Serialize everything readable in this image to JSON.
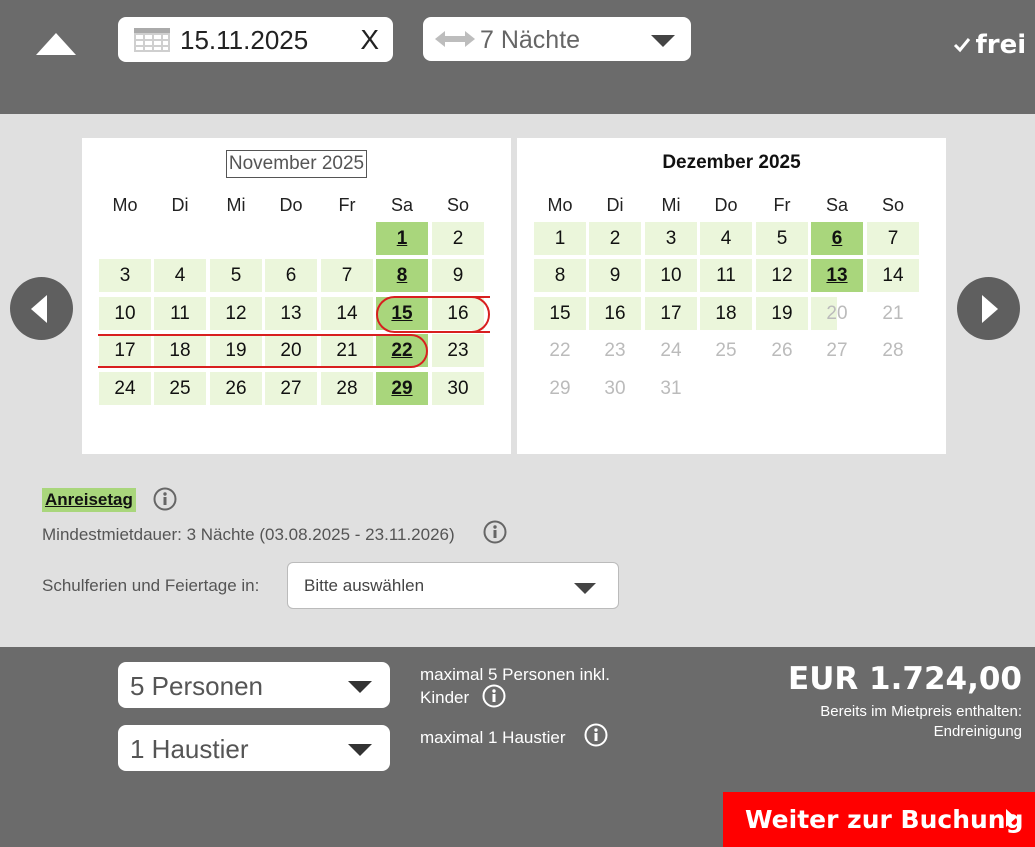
{
  "header": {
    "arrival_date": "15.11.2025",
    "clear_label": "X",
    "nights_label": "7 Nächte",
    "availability_label": "frei"
  },
  "calendar": {
    "weekdays": [
      "Mo",
      "Di",
      "Mi",
      "Do",
      "Fr",
      "Sa",
      "So"
    ],
    "months": [
      {
        "title": "November 2025",
        "days": [
          "1",
          "2",
          "3",
          "4",
          "5",
          "6",
          "7",
          "8",
          "9",
          "10",
          "11",
          "12",
          "13",
          "14",
          "15",
          "16",
          "17",
          "18",
          "19",
          "20",
          "21",
          "22",
          "23",
          "24",
          "25",
          "26",
          "27",
          "28",
          "29",
          "30"
        ],
        "arrival_days": [
          "1",
          "8",
          "15",
          "22",
          "29"
        ],
        "unavailable_days": [],
        "selected_range": [
          "15",
          "22"
        ]
      },
      {
        "title": "Dezember 2025",
        "days": [
          "1",
          "2",
          "3",
          "4",
          "5",
          "6",
          "7",
          "8",
          "9",
          "10",
          "11",
          "12",
          "13",
          "14",
          "15",
          "16",
          "17",
          "18",
          "19",
          "20",
          "21",
          "22",
          "23",
          "24",
          "25",
          "26",
          "27",
          "28",
          "29",
          "30",
          "31"
        ],
        "arrival_days": [
          "6",
          "13"
        ],
        "unavailable_days": [
          "20",
          "21",
          "22",
          "23",
          "24",
          "25",
          "26",
          "27",
          "28",
          "29",
          "30",
          "31"
        ],
        "partial_days": [
          "20"
        ]
      }
    ]
  },
  "legend": {
    "arrival_label": "Anreisetag"
  },
  "min_stay": {
    "text": "Mindestmietdauer: 3 Nächte (03.08.2025 - 23.11.2026)"
  },
  "holidays": {
    "label": "Schulferien und Feiertage in:",
    "selected": "Bitte auswählen"
  },
  "booking": {
    "persons_value": "5 Personen",
    "pets_value": "1 Haustier",
    "persons_note": "maximal 5 Personen inkl. Kinder",
    "pets_note": "maximal 1 Haustier",
    "price": "EUR 1.724,00",
    "included_line1": "Bereits im Mietpreis enthalten:",
    "included_line2": "Endreinigung",
    "book_button": "Weiter zur Buchung"
  },
  "colors": {
    "bar_bg": "#6b6b6b",
    "page_bg": "#e0e0e0",
    "available": "#ebf6db",
    "arrival": "#a9d67c",
    "selection": "#d81f1f",
    "book_button": "#ff0000"
  }
}
